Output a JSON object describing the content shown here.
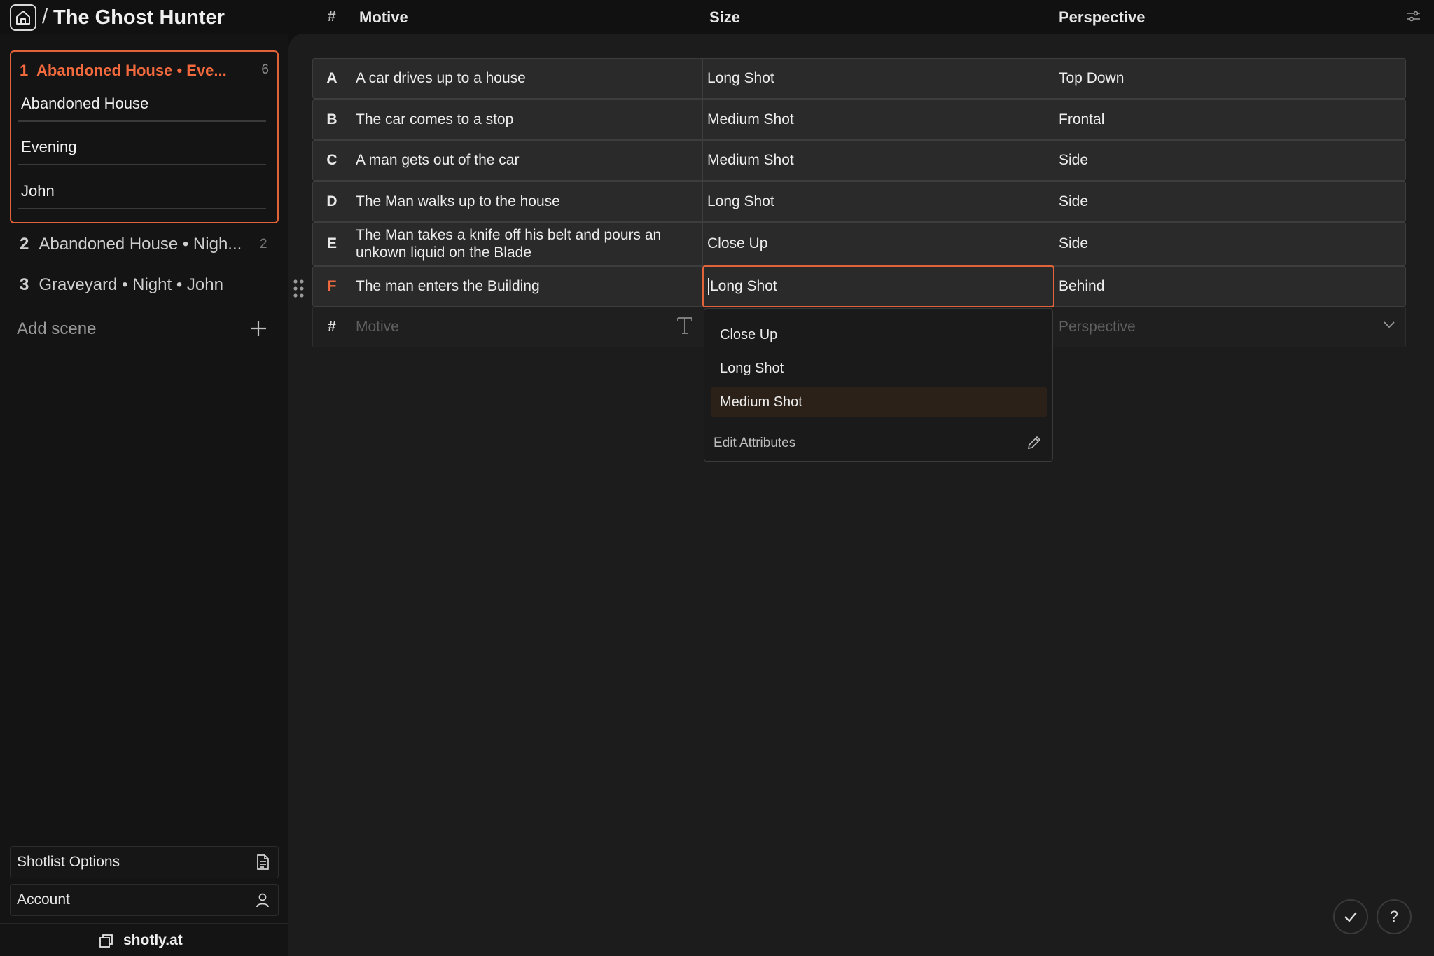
{
  "header": {
    "separator": "/",
    "project_title": "The Ghost Hunter",
    "columns": {
      "number": "#",
      "motive": "Motive",
      "size": "Size",
      "perspective": "Perspective"
    }
  },
  "sidebar": {
    "active_scene": {
      "number": "1",
      "title": "Abandoned House • Eve...",
      "count": "6",
      "attributes": [
        "Abandoned House",
        "Evening",
        "John"
      ]
    },
    "scenes": [
      {
        "number": "2",
        "title": "Abandoned House • Nigh...",
        "count": "2"
      },
      {
        "number": "3",
        "title": "Graveyard • Night • John",
        "count": ""
      }
    ],
    "add_scene_label": "Add scene",
    "shotlist_options_label": "Shotlist Options",
    "account_label": "Account",
    "footer_brand": "shotly.at"
  },
  "shots": [
    {
      "letter": "A",
      "motive": "A car drives up to a house",
      "size": "Long Shot",
      "perspective": "Top Down"
    },
    {
      "letter": "B",
      "motive": "The car comes to a stop",
      "size": "Medium Shot",
      "perspective": "Frontal"
    },
    {
      "letter": "C",
      "motive": "A man gets out of the car",
      "size": "Medium Shot",
      "perspective": "Side"
    },
    {
      "letter": "D",
      "motive": "The Man walks up to the house",
      "size": "Long Shot",
      "perspective": "Side"
    },
    {
      "letter": "E",
      "motive": "The Man takes a knife off his belt and pours an unkown liquid on the Blade",
      "size": "Close Up",
      "perspective": "Side"
    },
    {
      "letter": "F",
      "motive": "The man enters the Building",
      "size": "Long Shot",
      "perspective": "Behind"
    }
  ],
  "new_shot": {
    "hash": "#",
    "motive_placeholder": "Motive",
    "perspective_placeholder": "Perspective"
  },
  "size_dropdown": {
    "options": [
      "Close Up",
      "Long Shot",
      "Medium Shot"
    ],
    "highlighted": "Medium Shot",
    "edit_label": "Edit Attributes"
  },
  "floating": {
    "help_label": "?"
  },
  "colors": {
    "accent": "#e2623a",
    "background": "#111111",
    "panel": "#1c1c1c",
    "row": "#2a2a2a"
  }
}
